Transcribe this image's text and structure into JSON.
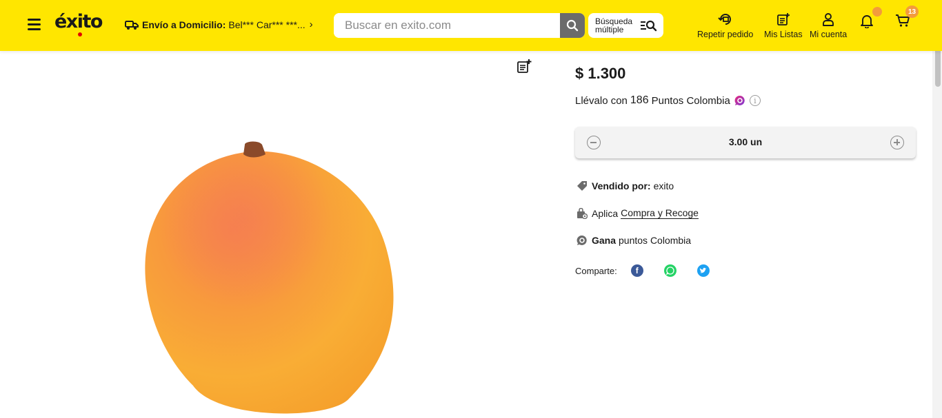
{
  "header": {
    "logo": "éxito",
    "delivery_label": "Envío a Domicilio:",
    "delivery_address": "Bel*** Car*** ***...",
    "search_placeholder": "Buscar en exito.com",
    "multi_search_line1": "Búsqueda",
    "multi_search_line2": "múltiple",
    "nav": [
      {
        "label": "Repetir pedido",
        "icon": "repeat-order-icon"
      },
      {
        "label": "Mis Listas",
        "icon": "list-add-icon"
      },
      {
        "label": "Mi cuenta",
        "icon": "user-icon"
      }
    ],
    "cart_count": "13"
  },
  "product": {
    "price": "$ 1.300",
    "points_prefix": "Llévalo con",
    "points_value": "186",
    "points_suffix": "Puntos Colombia",
    "quantity": "3.00 un",
    "sold_by_label": "Vendido por:",
    "sold_by_value": "exito",
    "pickup_prefix": "Aplica",
    "pickup_link": "Compra y Recoge",
    "earn_label": "Gana",
    "earn_value": "puntos Colombia",
    "share_label": "Comparte:"
  },
  "colors": {
    "brand_yellow": "#ffe600",
    "badge_orange": "#f39b3c",
    "facebook": "#3b5998",
    "whatsapp": "#25d366",
    "twitter": "#1da1f2"
  }
}
